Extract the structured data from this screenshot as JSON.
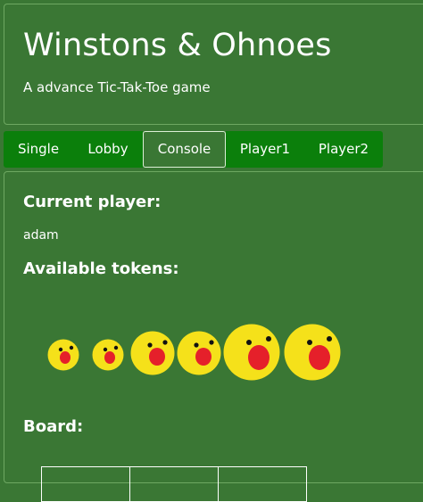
{
  "header": {
    "title": "Winstons & Ohnoes",
    "subtitle": "A advance Tic-Tak-Toe game"
  },
  "tabs": [
    {
      "label": "Single",
      "active": false
    },
    {
      "label": "Lobby",
      "active": false
    },
    {
      "label": "Console",
      "active": true
    },
    {
      "label": "Player1",
      "active": false
    },
    {
      "label": "Player2",
      "active": false
    }
  ],
  "game": {
    "current_player_label": "Current player:",
    "current_player": "adam",
    "available_tokens_label": "Available tokens:",
    "tokens": [
      {
        "size": "small",
        "icon": "ohnoes-face-icon"
      },
      {
        "size": "small",
        "icon": "ohnoes-face-icon"
      },
      {
        "size": "medium",
        "icon": "ohnoes-face-icon"
      },
      {
        "size": "medium",
        "icon": "ohnoes-face-icon"
      },
      {
        "size": "large",
        "icon": "ohnoes-face-icon"
      },
      {
        "size": "large",
        "icon": "ohnoes-face-icon"
      }
    ],
    "board_label": "Board:"
  },
  "colors": {
    "background": "#3a7734",
    "tab": "#0b7f0b",
    "token_face": "#f5e11a",
    "token_mouth": "#e5202a",
    "token_eye": "#111111"
  }
}
